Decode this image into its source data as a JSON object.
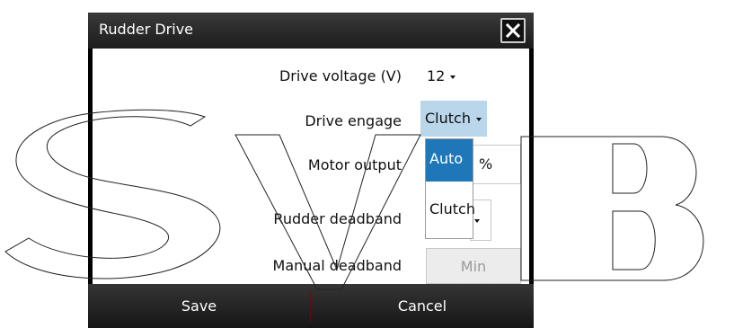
{
  "dialog": {
    "title": "Rudder Drive",
    "close_icon": "close-icon"
  },
  "rows": {
    "drive_voltage": {
      "label": "Drive voltage (V)",
      "value": "12"
    },
    "drive_engage": {
      "label": "Drive engage",
      "value": "Clutch"
    },
    "motor_output": {
      "label": "Motor output",
      "value": "%"
    },
    "rudder_deadband": {
      "label": "Rudder deadband"
    },
    "manual_deadband": {
      "label": "Manual deadband",
      "value": "Min"
    }
  },
  "dropdown": {
    "options": [
      "Auto",
      "Clutch"
    ],
    "highlighted": "Auto"
  },
  "footer": {
    "save_label": "Save",
    "cancel_label": "Cancel"
  },
  "colors": {
    "accent": "#1d77b9",
    "selected_field": "#b9d6ea",
    "title_bar": "#2a2a2a"
  }
}
